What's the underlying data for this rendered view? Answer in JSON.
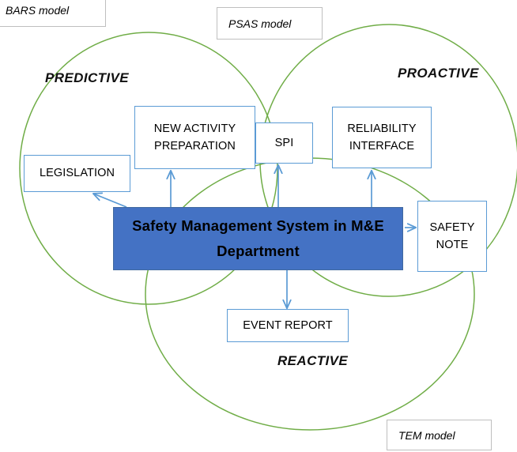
{
  "diagram": {
    "title": "Safety Management System in M&E Department",
    "colors": {
      "circle_stroke": "#70AD47",
      "box_stroke": "#5B9BD5",
      "primary_fill": "#4472C4",
      "arrow": "#5B9BD5",
      "callout_stroke": "#BFBFBF",
      "text": "#000000"
    }
  },
  "zones": [
    {
      "id": "predictive",
      "label": "PREDICTIVE"
    },
    {
      "id": "proactive",
      "label": "PROACTIVE"
    },
    {
      "id": "reactive",
      "label": "REACTIVE"
    }
  ],
  "callouts": [
    {
      "id": "bars",
      "label": "BARS model"
    },
    {
      "id": "psas",
      "label": "PSAS model"
    },
    {
      "id": "tem",
      "label": "TEM model"
    }
  ],
  "nodes": {
    "center": {
      "line1": "Safety Management System in M&E",
      "line2": "Department"
    },
    "legislation": {
      "line1": "LEGISLATION"
    },
    "new_activity": {
      "line1": "NEW ACTIVITY",
      "line2": "PREPARATION"
    },
    "spi": {
      "line1": "SPI"
    },
    "reliability": {
      "line1": "RELIABILITY",
      "line2": "INTERFACE"
    },
    "safety_note": {
      "line1": "SAFETY",
      "line2": "NOTE"
    },
    "event_report": {
      "line1": "EVENT REPORT"
    }
  }
}
